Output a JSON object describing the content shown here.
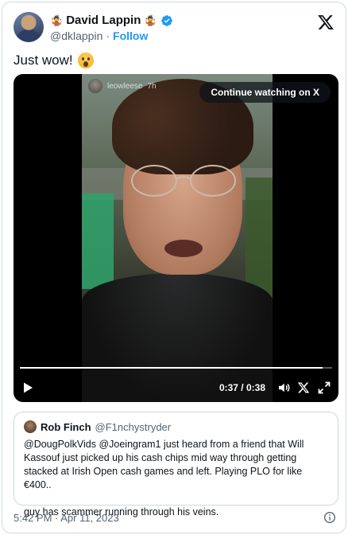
{
  "author": {
    "display_name": "David Lappin",
    "badge_emoji": "🤹",
    "handle": "@dklappin",
    "separator": "·",
    "follow_label": "Follow"
  },
  "tweet": {
    "text": "Just wow!",
    "emoji": "astonished-face"
  },
  "video": {
    "overlay_username": "leowleese",
    "overlay_time": "7h",
    "continue_label": "Continue watching on X",
    "time_display": "0:37 / 0:38",
    "progress_fraction": 0.97
  },
  "quote": {
    "name": "Rob Finch",
    "handle": "@F1nchystryder",
    "paragraph1": "@DougPolkVids @Joeingram1 just heard from a friend that Will Kassouf just picked up his cash chips mid way through getting stacked at Irish Open cash games and left. Playing PLO for like €400..",
    "paragraph2": "guy has scammer running through his veins."
  },
  "footer": {
    "timestamp": "5:42 PM · Apr 11, 2023"
  },
  "colors": {
    "accent": "#1d9bf0",
    "secondary_text": "#536471",
    "border": "#cfd9de"
  }
}
